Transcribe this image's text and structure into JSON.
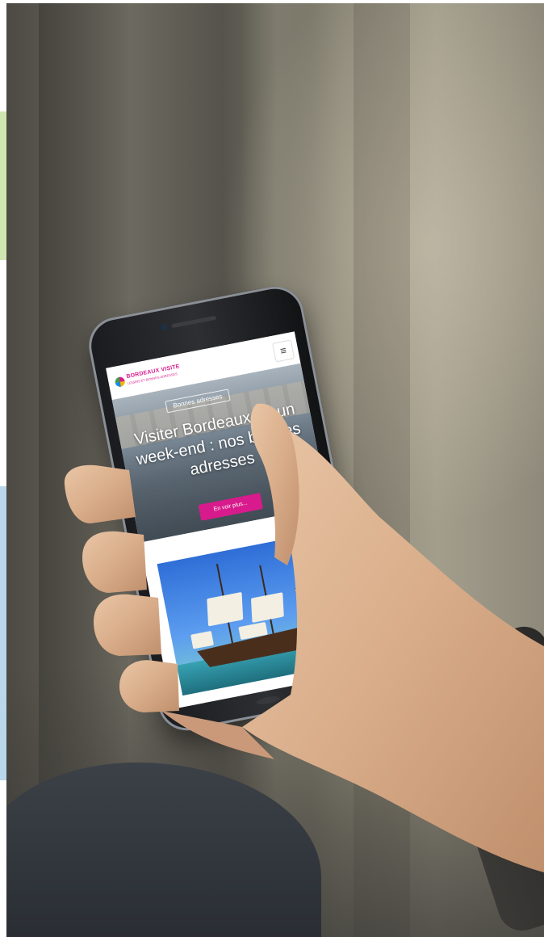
{
  "site": {
    "logo_text": "BORDEAUX VISITE",
    "logo_tagline": "LOISIRS ET BONNES ADRESSES",
    "menu_icon": "≡"
  },
  "hero": {
    "badge": "Bonnes adresses",
    "title": "Visiter Bordeaux en un week-end : nos bonnes adresses",
    "cta": "En voir plus..."
  },
  "colors": {
    "brand_pink": "#d81b8c",
    "stripe_green": "#cfe6b0",
    "stripe_blue": "#b9d6ea"
  }
}
